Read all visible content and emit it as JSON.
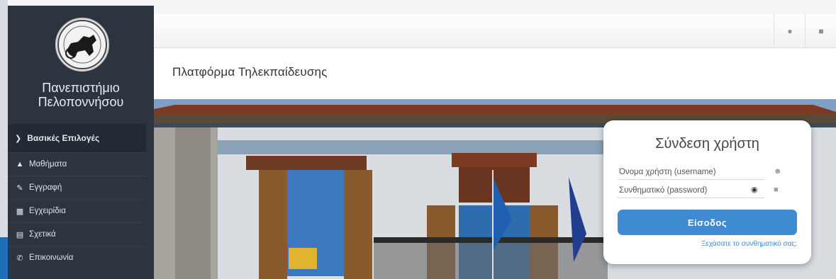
{
  "university": {
    "name_line1": "Πανεπιστήμιο",
    "name_line2": "Πελοποννήσου",
    "logo": "university-seal"
  },
  "sidebar": {
    "header_label": "Βασικές Επιλογές",
    "header_icon": "chevron-down-icon",
    "items": [
      {
        "label": "Μαθήματα",
        "icon": "graduation-cap-icon"
      },
      {
        "label": "Εγγραφή",
        "icon": "edit-icon"
      },
      {
        "label": "Εγχειρίδια",
        "icon": "file-icon"
      },
      {
        "label": "Σχετικά",
        "icon": "card-icon"
      },
      {
        "label": "Επικοινωνία",
        "icon": "phone-icon"
      }
    ]
  },
  "topbar": {
    "language_icon": "globe-icon",
    "login_icon": "lock-icon"
  },
  "page": {
    "title": "Πλατφόρμα Τηλεκπαίδευσης"
  },
  "login": {
    "title": "Σύνδεση χρήστη",
    "username_placeholder": "Όνομα χρήστη (username)",
    "password_placeholder": "Συνθηματικό (password)",
    "submit_label": "Είσοδος",
    "forgot_label": "Ξεχάσατε το συνθηματικό σας;"
  },
  "colors": {
    "sidebar_bg": "#2c3440",
    "accent": "#3f8bd1"
  }
}
